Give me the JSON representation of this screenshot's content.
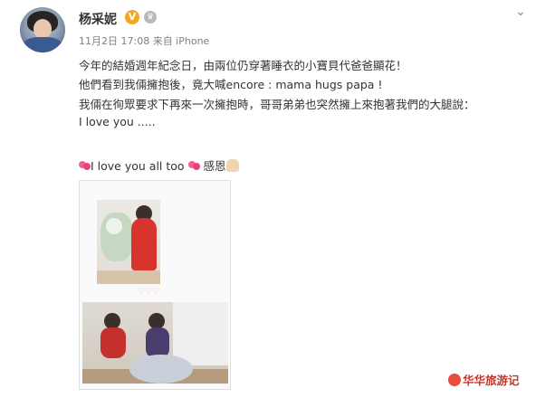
{
  "post": {
    "author_name": "杨采妮",
    "verified_badge": "V",
    "timestamp": "11月2日 17:08 来自 iPhone",
    "lines": [
      "今年的結婚週年紀念日，由兩位仍穿著睡衣的小寶貝代爸爸顯花！",
      "他們看到我倆擁抱後，竟大喊encore : mama hugs papa !",
      "我倆在徇眾要求下再來一次擁抱時，哥哥弟弟也突然擁上來抱著我們的大腿說：",
      "I love you .....",
      "I love you all too",
      "感恩"
    ],
    "icons": {
      "menu": "chevron-down-icon",
      "heart": "two-hearts-emoji",
      "pray": "praying-hands-emoji"
    }
  },
  "watermark": {
    "text": "华华旅游记"
  }
}
